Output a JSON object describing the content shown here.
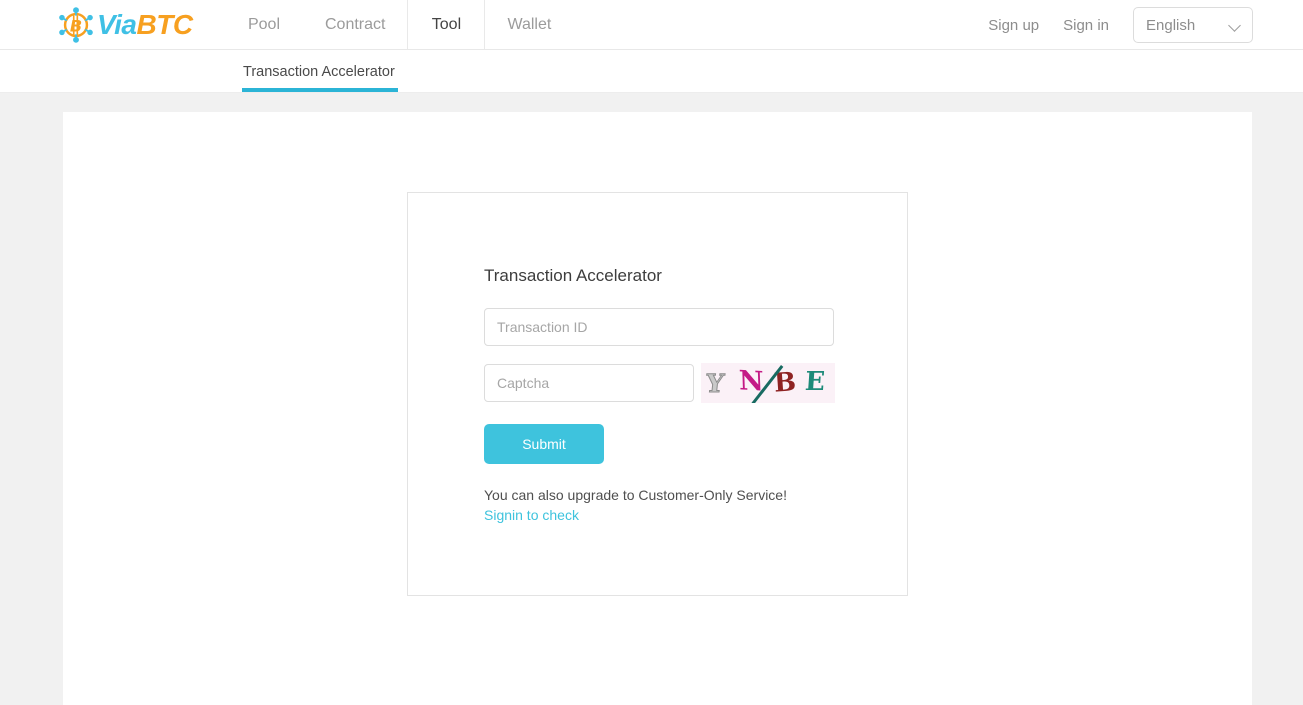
{
  "header": {
    "brand": {
      "icon": "bitcoin-node-icon",
      "part1": "Via",
      "part2": "BTC"
    },
    "nav": [
      {
        "label": "Pool",
        "active": false
      },
      {
        "label": "Contract",
        "active": false
      },
      {
        "label": "Tool",
        "active": true
      },
      {
        "label": "Wallet",
        "active": false
      }
    ],
    "auth": {
      "sign_up": "Sign up",
      "sign_in": "Sign in"
    },
    "language": {
      "selected": "English",
      "icon": "chevron-down-icon"
    }
  },
  "subnav": {
    "tabs": [
      {
        "label": "Transaction Accelerator",
        "active": true
      }
    ],
    "accent_color": "#2bb4d6"
  },
  "main": {
    "card": {
      "title": "Transaction Accelerator",
      "txid_placeholder": "Transaction ID",
      "txid_value": "",
      "captcha_placeholder": "Captcha",
      "captcha_value": "",
      "captcha_image": {
        "name": "captcha-image",
        "characters": [
          "Y",
          "N",
          "B",
          "E"
        ],
        "text": "YNBE",
        "colors": [
          "#c9c9c9",
          "#c41a86",
          "#8e2323",
          "#1d8a79"
        ],
        "background": "#fbf1f7",
        "strike_color": "#186b61"
      },
      "submit_label": "Submit",
      "submit_color": "#3ec3dd",
      "note_text": "You can also upgrade to Customer-Only Service!",
      "note_link": "Signin to check",
      "note_link_color": "#3ec3dd"
    }
  },
  "theme": {
    "page_background": "#f1f1f1",
    "panel_background": "#ffffff",
    "brand_teal": "#3fc0e5",
    "brand_orange": "#f7a020"
  }
}
